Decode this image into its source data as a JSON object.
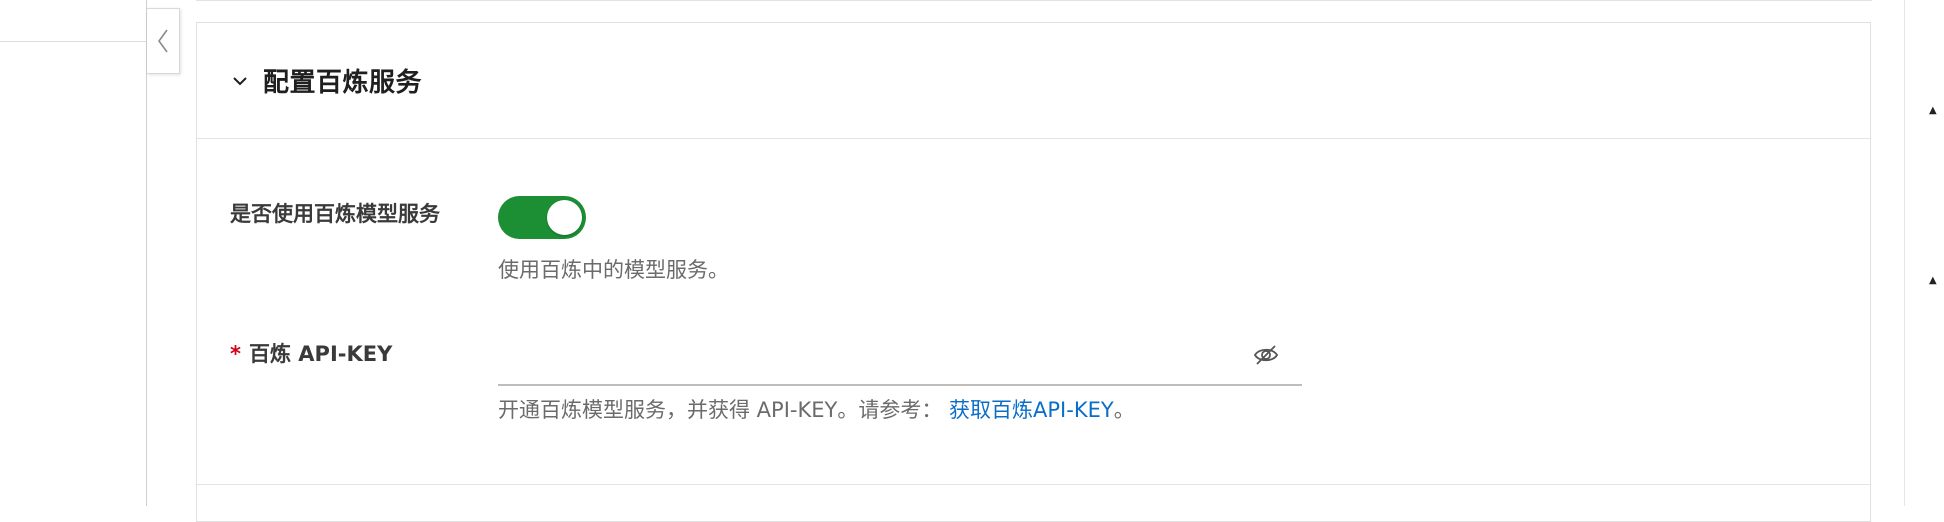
{
  "sidebar": {
    "collapse_icon": "chevron-left-icon"
  },
  "section": {
    "title": "配置百炼服务",
    "expand_icon": "chevron-down-icon"
  },
  "use_service": {
    "label": "是否使用百炼模型服务",
    "enabled": true,
    "toggle_color": "#1c8f35",
    "helper": "使用百炼中的模型服务。"
  },
  "api_key": {
    "required_mark": "*",
    "label": "百炼 API-KEY",
    "value": "",
    "visibility_icon": "eye-off-icon",
    "helper_prefix": "开通百炼模型服务，并获得 API-KEY。请参考：",
    "helper_link": "获取百炼API-KEY",
    "helper_suffix": "。",
    "link_color": "#0a6ec9"
  },
  "scrollbar": {
    "up_arrow": "▲",
    "up_arrow_2": "▲"
  }
}
